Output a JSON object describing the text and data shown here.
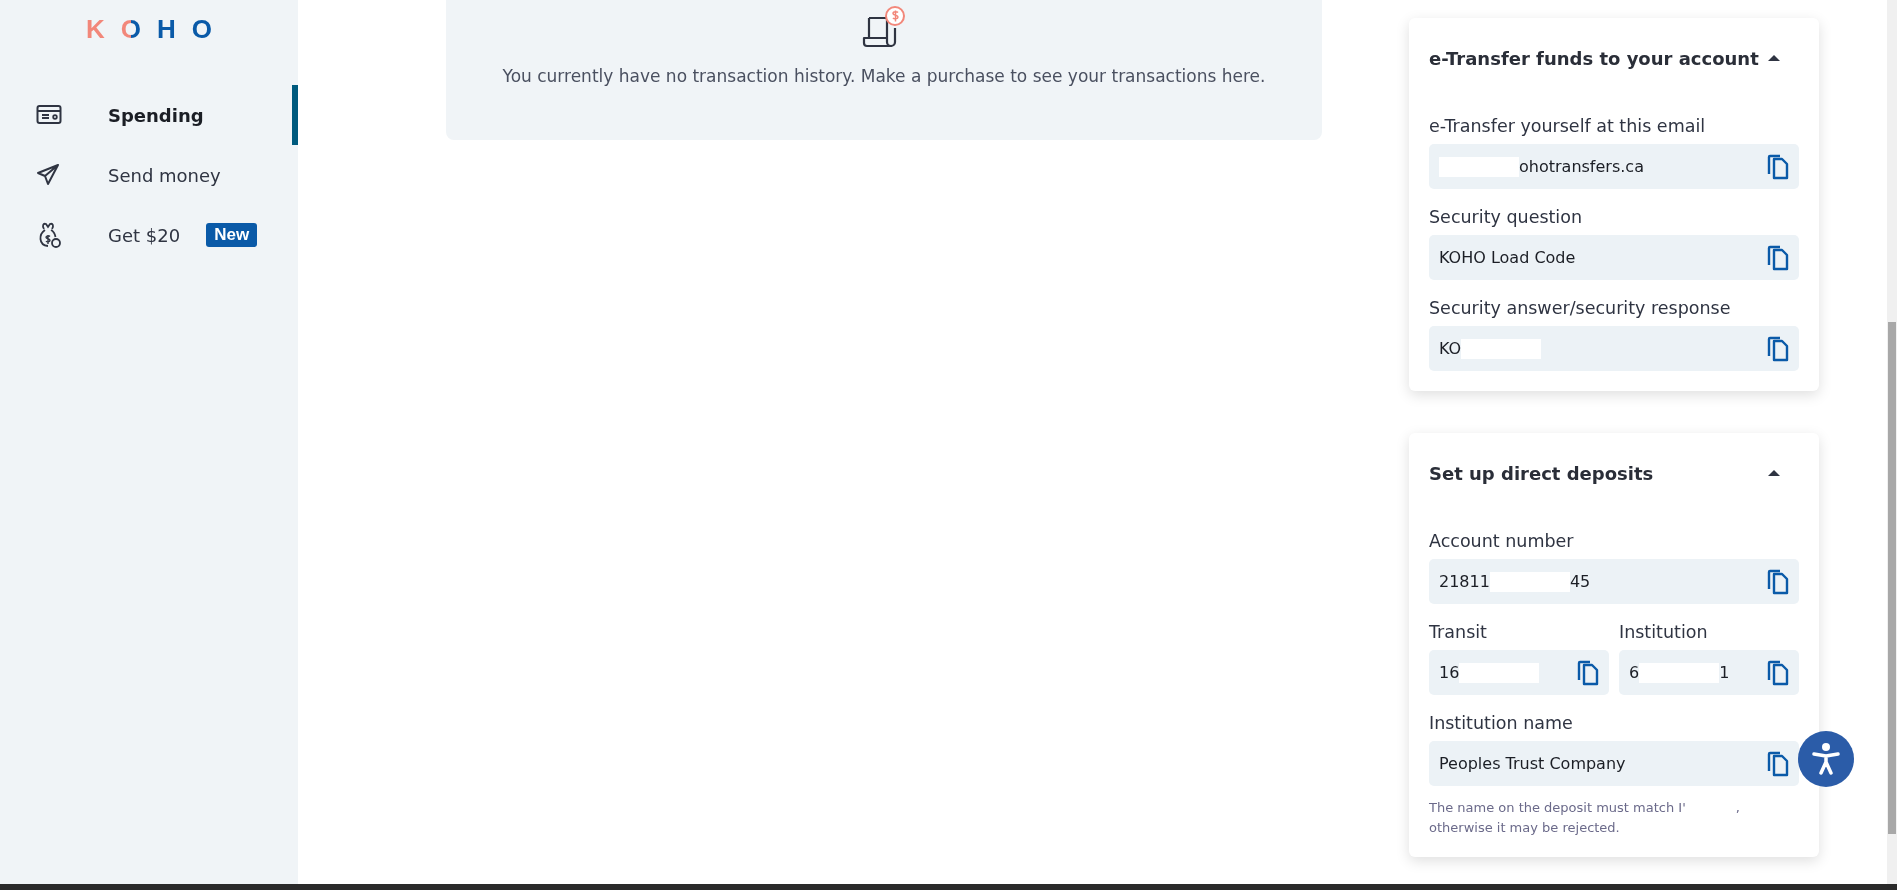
{
  "logo": {
    "letters": [
      "K",
      "O",
      "H",
      "O"
    ]
  },
  "sidebar": {
    "items": [
      {
        "label": "Spending",
        "selected": true
      },
      {
        "label": "Send money",
        "selected": false
      },
      {
        "label": "Get $20",
        "selected": false,
        "badge": "New"
      }
    ]
  },
  "empty_state": {
    "message": "You currently have no transaction history. Make a purchase to see your transactions here."
  },
  "panels": [
    {
      "title": "e-Transfer funds to your account",
      "expanded": true,
      "rows": [
        [
          {
            "label": "e-Transfer yourself at this email",
            "value_end": "ohotransfers.ca",
            "redacted": true
          }
        ],
        [
          {
            "label": "Security question",
            "value": "KOHO Load Code",
            "redacted": false
          }
        ],
        [
          {
            "label": "Security answer/security response",
            "value": "KO",
            "redacted": true
          }
        ]
      ]
    },
    {
      "title": "Set up direct deposits",
      "expanded": true,
      "rows": [
        [
          {
            "label": "Account number",
            "value": "21811",
            "value_end": "45",
            "redacted": true
          }
        ],
        [
          {
            "label": "Transit",
            "value": "16",
            "redacted": true
          },
          {
            "label": "Institution",
            "value": "6",
            "value_end": "1",
            "redacted": true
          }
        ],
        [
          {
            "label": "Institution name",
            "value": "Peoples Trust Company",
            "redacted": false
          }
        ]
      ],
      "note": "The name on the deposit must match I'",
      "note_end": ",",
      "note_line2": "otherwise it may be rejected."
    }
  ]
}
